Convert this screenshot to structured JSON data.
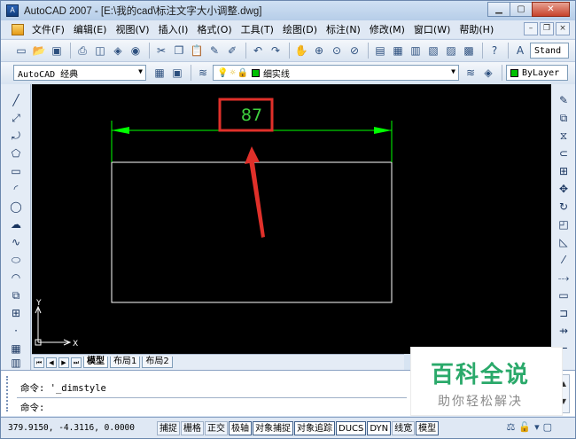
{
  "window": {
    "title": "AutoCAD 2007 - [E:\\我的cad\\标注文字大小调整.dwg]",
    "app_icon": "autocad-logo-icon",
    "buttons": {
      "minimize": "▁",
      "maximize": "▢",
      "close": "✕"
    }
  },
  "menubar": {
    "items": [
      {
        "label": "文件(F)"
      },
      {
        "label": "编辑(E)"
      },
      {
        "label": "视图(V)"
      },
      {
        "label": "插入(I)"
      },
      {
        "label": "格式(O)"
      },
      {
        "label": "工具(T)"
      },
      {
        "label": "绘图(D)"
      },
      {
        "label": "标注(N)"
      },
      {
        "label": "修改(M)"
      },
      {
        "label": "窗口(W)"
      },
      {
        "label": "帮助(H)"
      }
    ],
    "mdi_buttons": {
      "minimize": "–",
      "restore": "❐",
      "close": "×"
    }
  },
  "toolbar_standard": {
    "text_style_label": "Stand"
  },
  "toolbar_workspace": {
    "workspace": "AutoCAD 经典",
    "linetype": "细实线",
    "lineweight": "ByLayer"
  },
  "drawing": {
    "dimension_text": "87",
    "colors": {
      "dimension": "#00ff00",
      "dimension_text": "#3fd13f",
      "rectangle": "#ffffff",
      "highlight": "#e0302a",
      "ucs": "#ffffff"
    },
    "ucs_labels": {
      "x": "X",
      "y": "Y"
    }
  },
  "layout_tabs": [
    {
      "label": "模型",
      "active": true
    },
    {
      "label": "布局1",
      "active": false
    },
    {
      "label": "布局2",
      "active": false
    }
  ],
  "command": {
    "history": "命令: '_dimstyle",
    "prompt": "命令:"
  },
  "status": {
    "coordinates": "379.9150, -4.3116, 0.0000",
    "toggles": [
      {
        "label": "捕捉",
        "on": false
      },
      {
        "label": "栅格",
        "on": false
      },
      {
        "label": "正交",
        "on": false
      },
      {
        "label": "极轴",
        "on": true
      },
      {
        "label": "对象捕捉",
        "on": true
      },
      {
        "label": "对象追踪",
        "on": true
      },
      {
        "label": "DUCS",
        "on": true
      },
      {
        "label": "DYN",
        "on": true
      },
      {
        "label": "线宽",
        "on": false
      },
      {
        "label": "模型",
        "on": true
      }
    ]
  },
  "watermark": {
    "title": "百科全说",
    "subtitle": "助你轻松解决"
  }
}
